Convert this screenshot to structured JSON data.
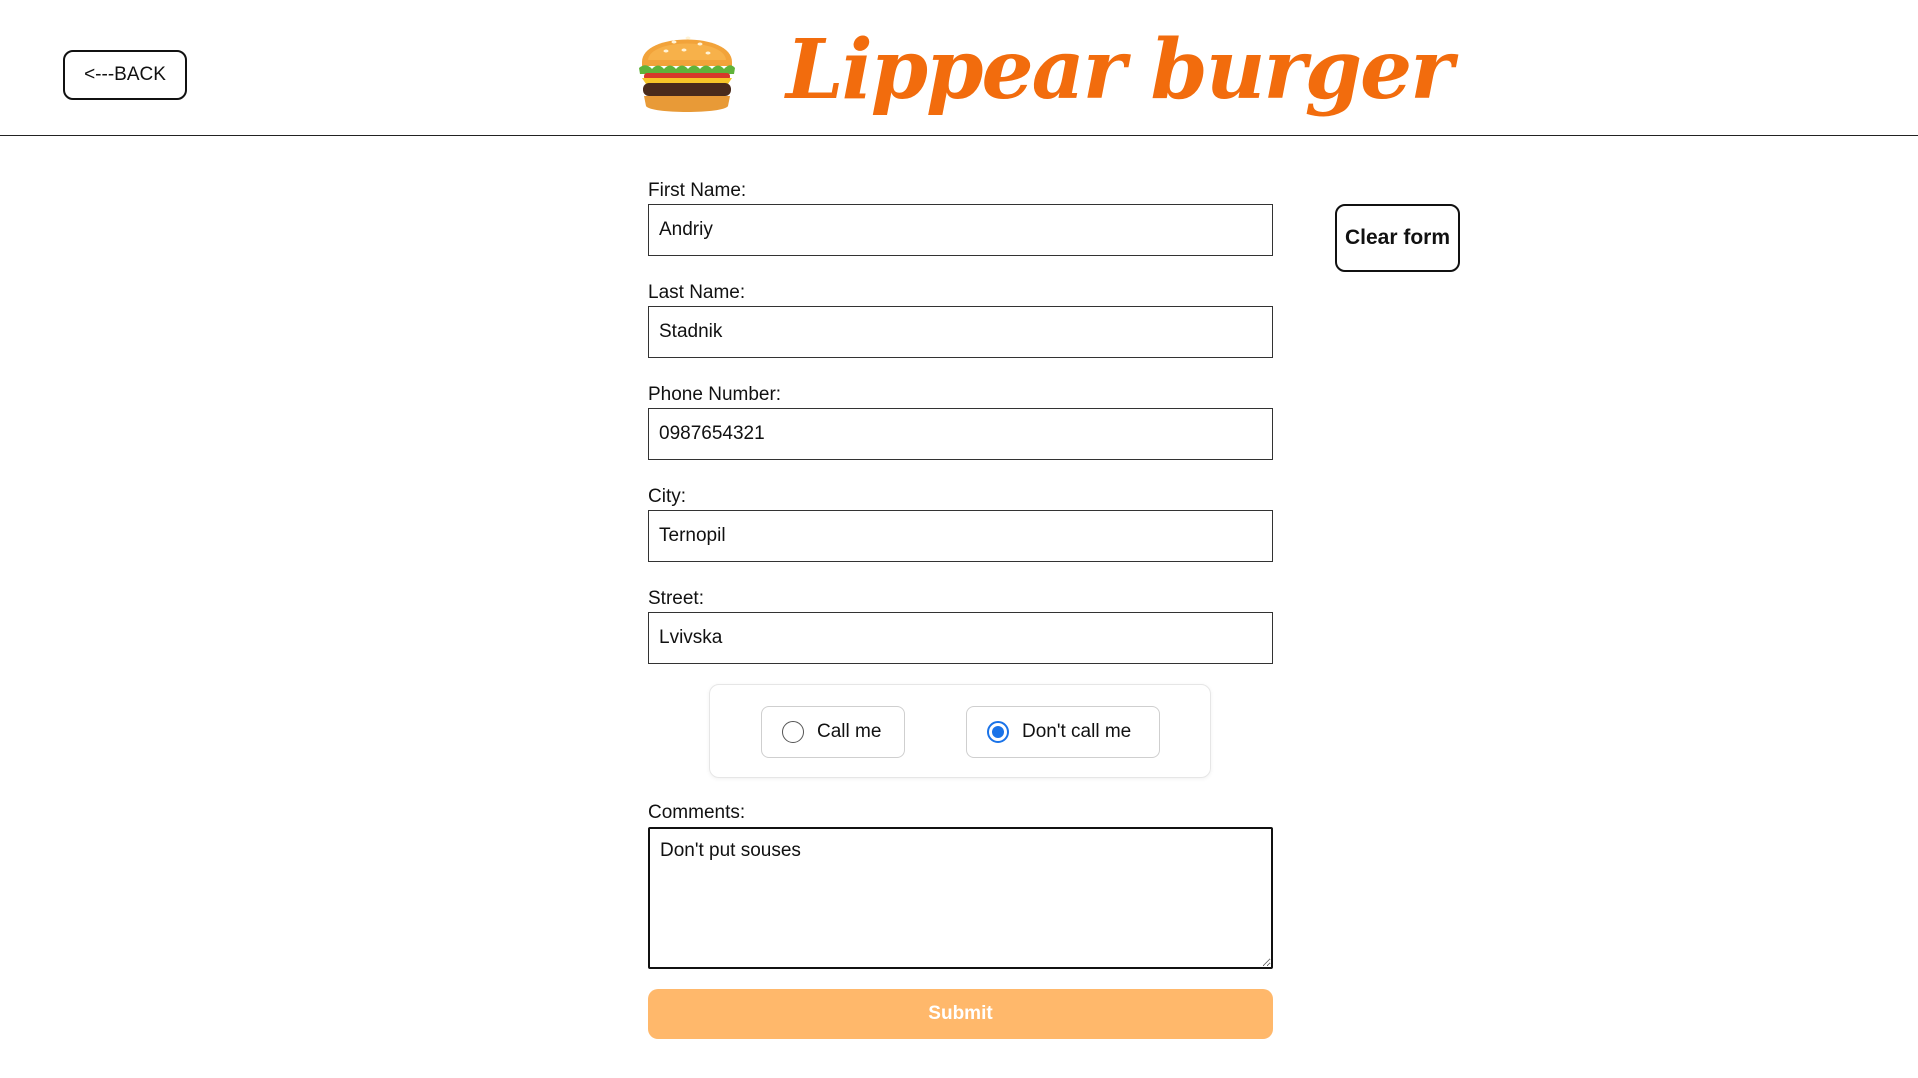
{
  "header": {
    "back_label": "<---BACK",
    "brand_name": "Lippear burger",
    "logo_icon": "burger-icon",
    "brand_color": "#f26c0d"
  },
  "form": {
    "fields": [
      {
        "label": "First Name:",
        "value": "Andriy"
      },
      {
        "label": "Last Name:",
        "value": "Stadnik"
      },
      {
        "label": "Phone Number:",
        "value": "0987654321"
      },
      {
        "label": "City:",
        "value": "Ternopil"
      },
      {
        "label": "Street:",
        "value": "Lvivska"
      }
    ],
    "clear_label": "Clear form",
    "contact_options": [
      {
        "label": "Call me",
        "checked": false
      },
      {
        "label": "Don't call me",
        "checked": true
      }
    ],
    "comments_label": "Comments:",
    "comments_value": "Don't put souses",
    "submit_label": "Submit",
    "submit_color": "#ffb86b",
    "radio_accent": "#1a73e8"
  }
}
